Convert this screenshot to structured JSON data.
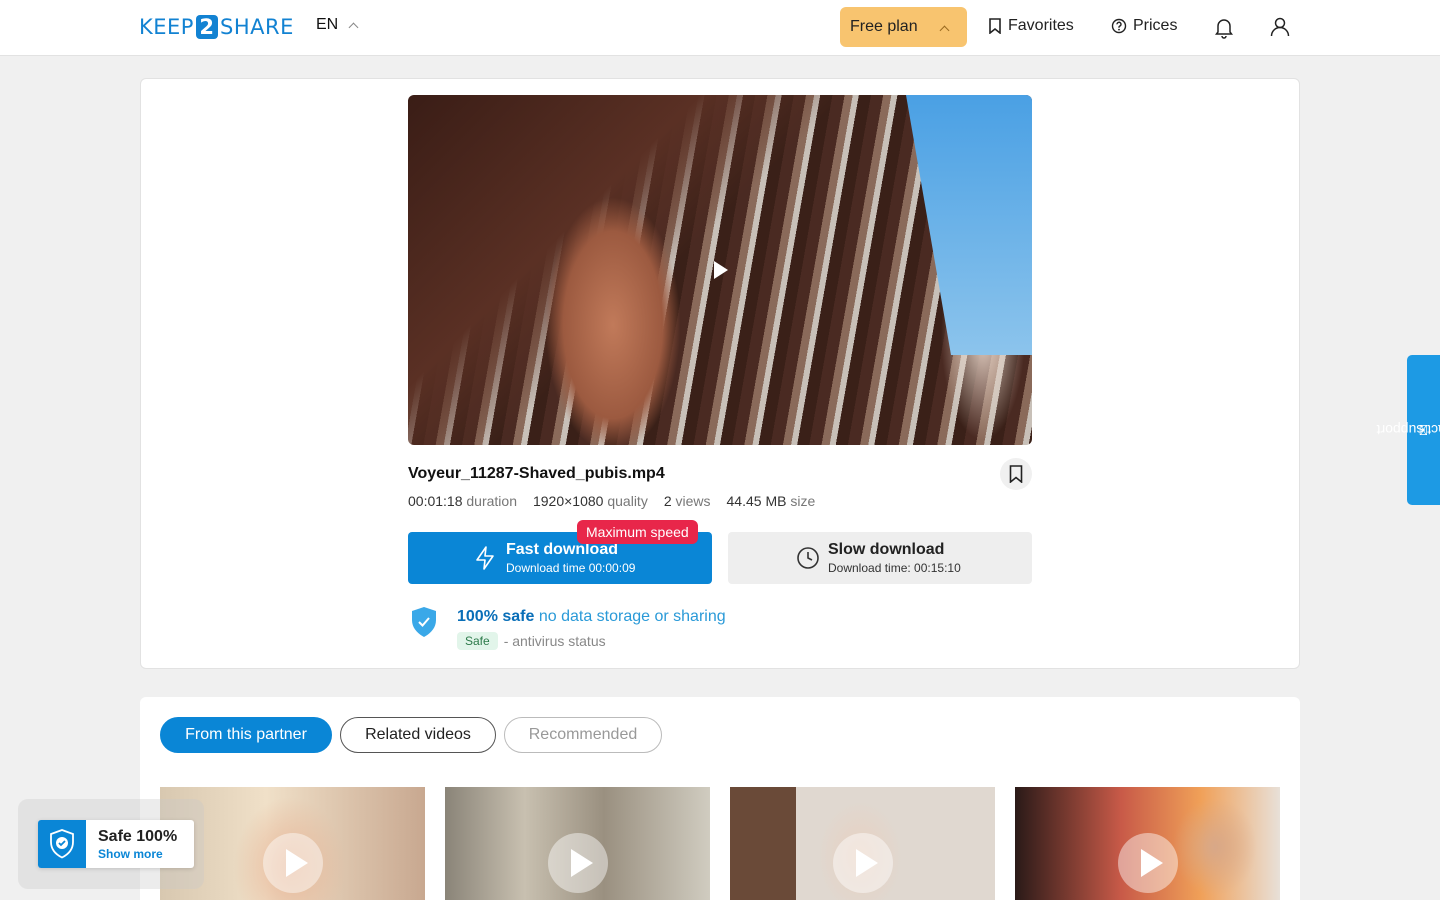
{
  "header": {
    "logo": {
      "left": "KEEP",
      "mid": "2",
      "right": "SHARE"
    },
    "language": "EN",
    "plan_label": "Free plan",
    "favorites_label": "Favorites",
    "prices_label": "Prices"
  },
  "file": {
    "name": "Voyeur_11287-Shaved_pubis.mp4",
    "duration_value": "00:01:18",
    "duration_label": "duration",
    "quality_value": "1920×1080",
    "quality_label": "quality",
    "views_value": "2",
    "views_label": "views",
    "size_value": "44.45 MB",
    "size_label": "size"
  },
  "download": {
    "badge": "Maximum speed",
    "fast_title": "Fast download",
    "fast_sub": "Download time 00:00:09",
    "slow_title": "Slow download",
    "slow_sub": "Download time: 00:15:10"
  },
  "safety": {
    "headline": "100% safe",
    "subline": "no data storage or sharing",
    "badge": "Safe",
    "status": "- antivirus status"
  },
  "support_label": "contact support",
  "tabs": [
    {
      "label": "From this partner",
      "state": "active"
    },
    {
      "label": "Related videos",
      "state": "normal"
    },
    {
      "label": "Recommended",
      "state": "muted"
    }
  ],
  "popup": {
    "title": "Safe 100%",
    "link": "Show more"
  },
  "colors": {
    "accent": "#0a86d6",
    "plan": "#f8c46f",
    "badge_red": "#e8264a"
  }
}
